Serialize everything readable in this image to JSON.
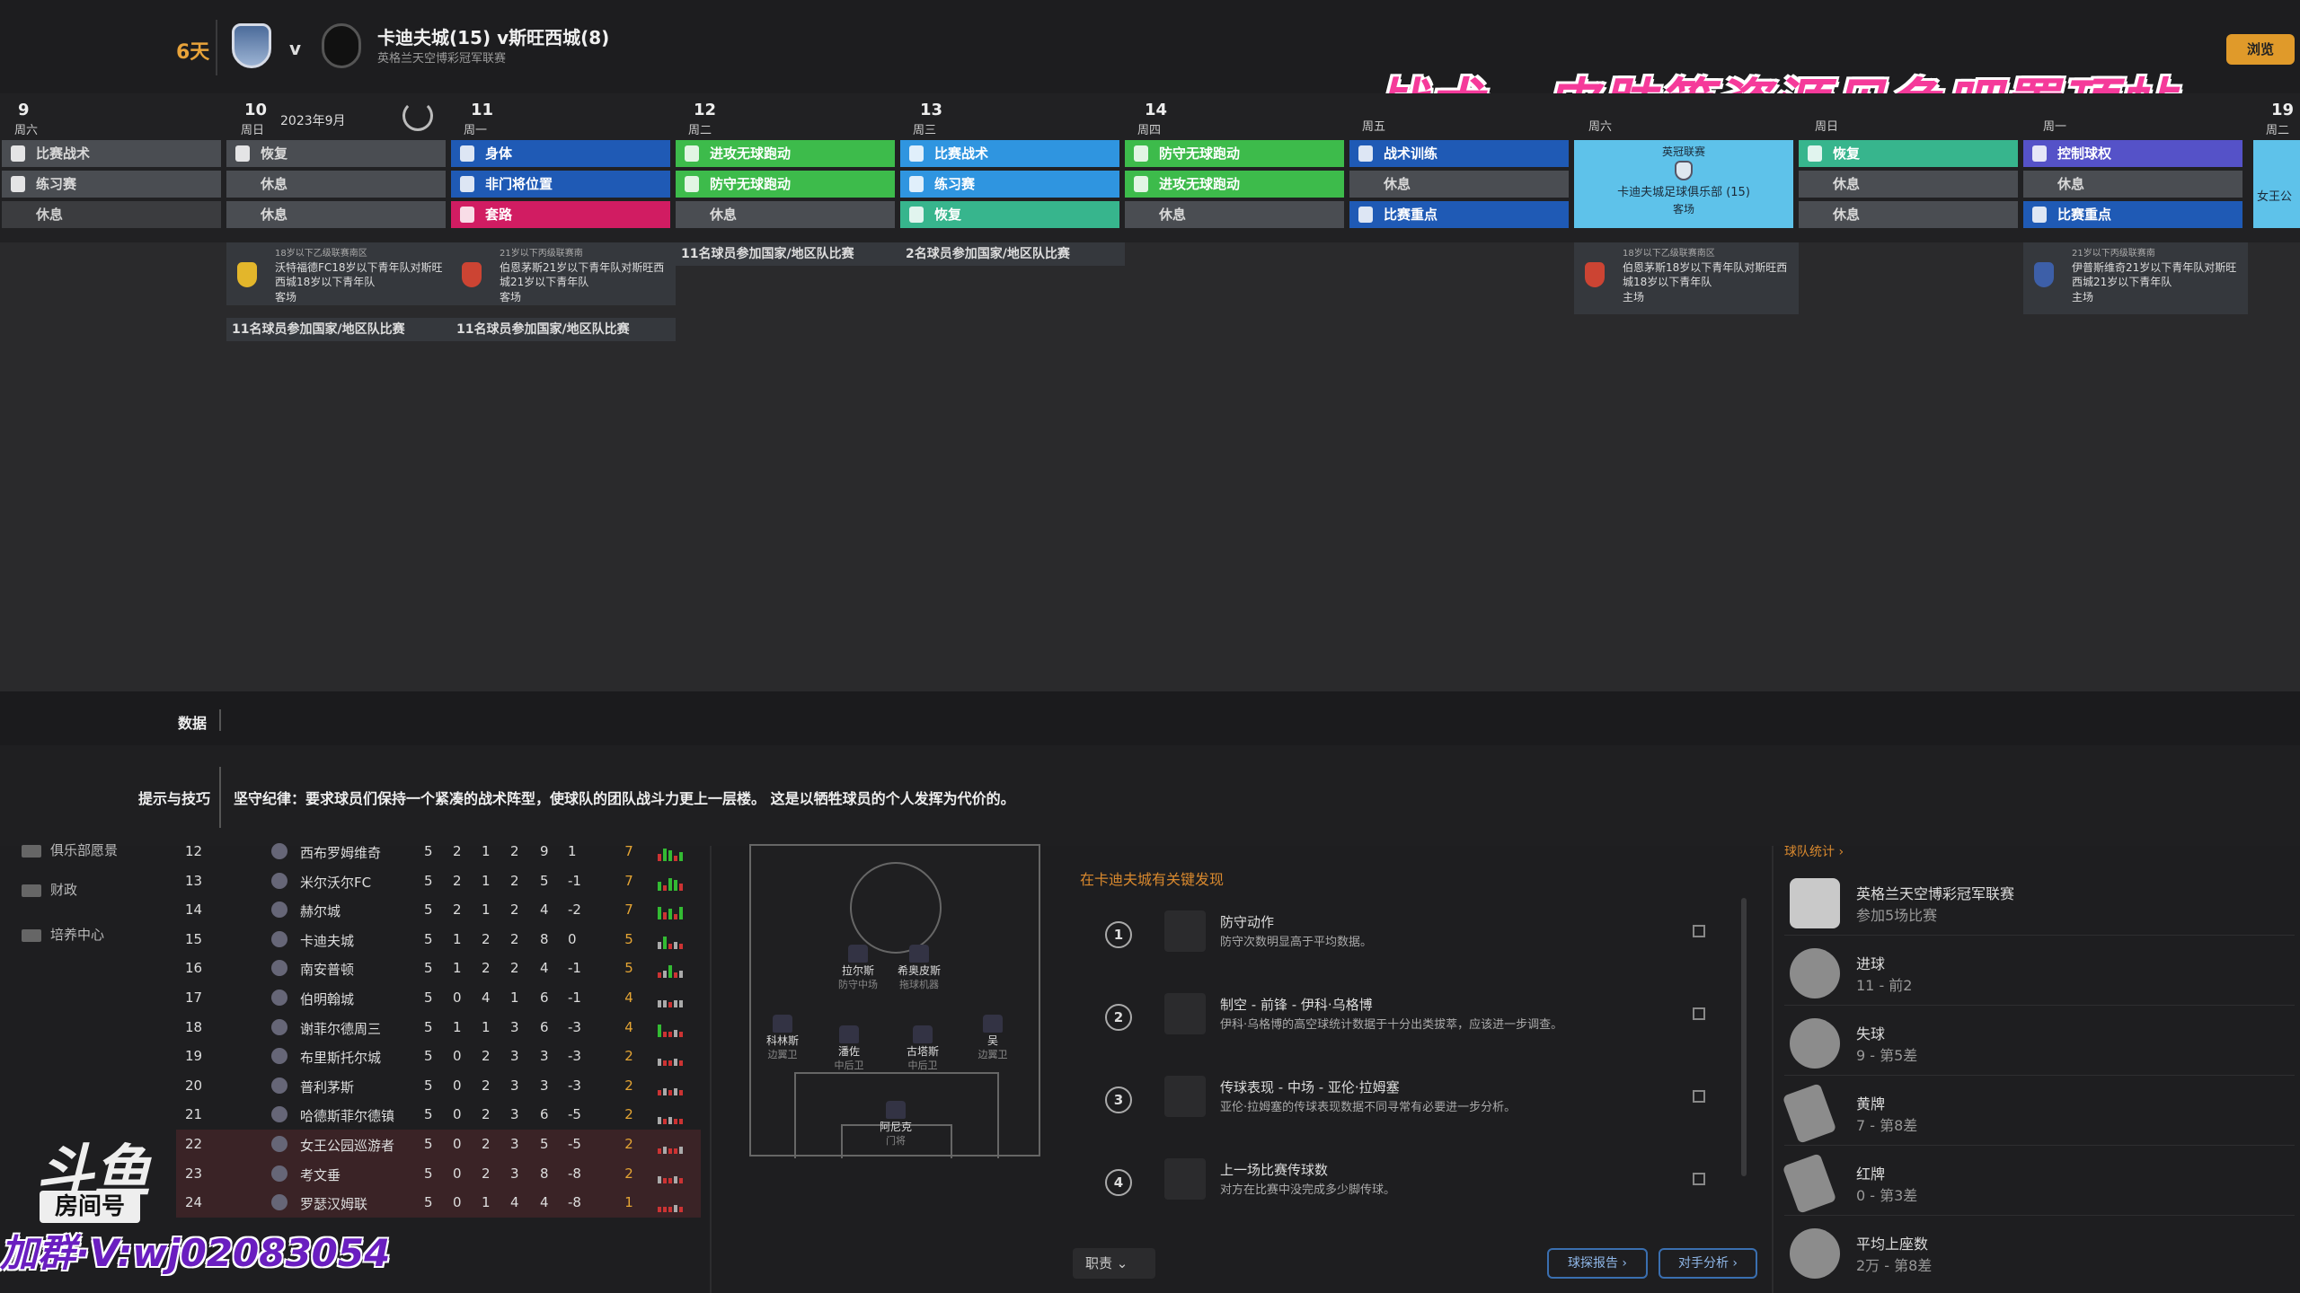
{
  "header": {
    "days_left": "6天",
    "vs": "v",
    "match_title": "卡迪夫城(15) v斯旺西城(8)",
    "competition": "英格兰天空博彩冠军联赛",
    "overview_button": "浏览"
  },
  "banner": "战术、皮肤等资源见鱼吧置顶帖",
  "calendar": {
    "month_label": "2023年9月",
    "days": [
      {
        "num": "9",
        "name": "周六",
        "slots": [
          "比赛战术",
          "练习赛",
          "休息"
        ]
      },
      {
        "num": "10",
        "name": "周日",
        "slots": [
          "恢复",
          "休息",
          "休息"
        ]
      },
      {
        "num": "11",
        "name": "周一",
        "slots": [
          "身体",
          "非门将位置",
          "套路"
        ]
      },
      {
        "num": "12",
        "name": "周二",
        "slots": [
          "进攻无球跑动",
          "防守无球跑动",
          "休息"
        ]
      },
      {
        "num": "13",
        "name": "周三",
        "slots": [
          "比赛战术",
          "练习赛",
          "恢复"
        ]
      },
      {
        "num": "14",
        "name": "周四",
        "slots": [
          "防守无球跑动",
          "进攻无球跑动",
          "休息"
        ]
      },
      {
        "num": "",
        "name": "周五",
        "slots": [
          "战术训练",
          "休息",
          "比赛重点"
        ]
      },
      {
        "num": "",
        "name": "周六",
        "slots": []
      },
      {
        "num": "",
        "name": "周日",
        "slots": [
          "恢复",
          "休息",
          "休息"
        ]
      },
      {
        "num": "",
        "name": "周一",
        "slots": [
          "控制球权",
          "休息",
          "比赛重点"
        ]
      },
      {
        "num": "19",
        "name": "周二",
        "slots": [
          "女王公"
        ]
      }
    ],
    "match_day": {
      "competition": "英冠联赛",
      "team": "卡迪夫城足球俱乐部 (15)",
      "venue": "客场"
    },
    "youth_cards": [
      {
        "league": "18岁以下乙级联赛南区",
        "text": "沃特福德FC18岁以下青年队对斯旺西城18岁以下青年队",
        "venue": "客场"
      },
      {
        "league": "21岁以下丙级联赛南",
        "text": "伯恩茅斯21岁以下青年队对斯旺西城21岁以下青年队",
        "venue": "客场"
      },
      {
        "league": "18岁以下乙级联赛南区",
        "text": "伯恩茅斯18岁以下青年队对斯旺西城18岁以下青年队",
        "venue": "主场"
      },
      {
        "league": "21岁以下丙级联赛南",
        "text": "伊普斯维奇21岁以下青年队对斯旺西城21岁以下青年队",
        "venue": "主场"
      }
    ],
    "notes": [
      "11名球员参加国家/地区队比赛",
      "11名球员参加国家/地区队比赛",
      "11名球员参加国家/地区队比赛",
      "2名球员参加国家/地区队比赛"
    ]
  },
  "data_label": "数据",
  "tips": {
    "label": "提示与技巧",
    "text": "坚守纪律：要求球员们保持一个紧凑的战术阵型，使球队的团队战斗力更上一层楼。 这是以牺牲球员的个人发挥为代价的。"
  },
  "sidebar": [
    "俱乐部愿景",
    "财政",
    "培养中心"
  ],
  "league_table": [
    {
      "pos": "12",
      "team": "西布罗姆维奇",
      "p": "5",
      "w": "2",
      "d": "1",
      "l": "2",
      "gf": "9",
      "gd": "1",
      "pts": "7",
      "hl": false
    },
    {
      "pos": "13",
      "team": "米尔沃尔FC",
      "p": "5",
      "w": "2",
      "d": "1",
      "l": "2",
      "gf": "5",
      "gd": "-1",
      "pts": "7",
      "hl": false
    },
    {
      "pos": "14",
      "team": "赫尔城",
      "p": "5",
      "w": "2",
      "d": "1",
      "l": "2",
      "gf": "4",
      "gd": "-2",
      "pts": "7",
      "hl": false
    },
    {
      "pos": "15",
      "team": "卡迪夫城",
      "p": "5",
      "w": "1",
      "d": "2",
      "l": "2",
      "gf": "8",
      "gd": "0",
      "pts": "5",
      "hl": false
    },
    {
      "pos": "16",
      "team": "南安普顿",
      "p": "5",
      "w": "1",
      "d": "2",
      "l": "2",
      "gf": "4",
      "gd": "-1",
      "pts": "5",
      "hl": false
    },
    {
      "pos": "17",
      "team": "伯明翰城",
      "p": "5",
      "w": "0",
      "d": "4",
      "l": "1",
      "gf": "6",
      "gd": "-1",
      "pts": "4",
      "hl": false
    },
    {
      "pos": "18",
      "team": "谢菲尔德周三",
      "p": "5",
      "w": "1",
      "d": "1",
      "l": "3",
      "gf": "6",
      "gd": "-3",
      "pts": "4",
      "hl": false
    },
    {
      "pos": "19",
      "team": "布里斯托尔城",
      "p": "5",
      "w": "0",
      "d": "2",
      "l": "3",
      "gf": "3",
      "gd": "-3",
      "pts": "2",
      "hl": false
    },
    {
      "pos": "20",
      "team": "普利茅斯",
      "p": "5",
      "w": "0",
      "d": "2",
      "l": "3",
      "gf": "3",
      "gd": "-3",
      "pts": "2",
      "hl": false
    },
    {
      "pos": "21",
      "team": "哈德斯菲尔德镇",
      "p": "5",
      "w": "0",
      "d": "2",
      "l": "3",
      "gf": "6",
      "gd": "-5",
      "pts": "2",
      "hl": false
    },
    {
      "pos": "22",
      "team": "女王公园巡游者",
      "p": "5",
      "w": "0",
      "d": "2",
      "l": "3",
      "gf": "5",
      "gd": "-5",
      "pts": "2",
      "hl": true
    },
    {
      "pos": "23",
      "team": "考文垂",
      "p": "5",
      "w": "0",
      "d": "2",
      "l": "3",
      "gf": "8",
      "gd": "-8",
      "pts": "2",
      "hl": true
    },
    {
      "pos": "24",
      "team": "罗瑟汉姆联",
      "p": "5",
      "w": "0",
      "d": "1",
      "l": "4",
      "gf": "4",
      "gd": "-8",
      "pts": "1",
      "hl": true
    }
  ],
  "pitch_players": [
    {
      "name": "拉尔斯",
      "role": "防守中场"
    },
    {
      "name": "希奥皮斯",
      "role": "拖球机器"
    },
    {
      "name": "科林斯",
      "role": "边翼卫"
    },
    {
      "name": "潘佐",
      "role": "中后卫"
    },
    {
      "name": "古塔斯",
      "role": "中后卫"
    },
    {
      "name": "吴",
      "role": "边翼卫"
    },
    {
      "name": "阿尼克",
      "role": "门将"
    }
  ],
  "findings": {
    "title": "在卡迪夫城有关键发现",
    "items": [
      {
        "num": "1",
        "head": "防守动作",
        "sub": "防守次数明显高于平均数据。"
      },
      {
        "num": "2",
        "head": "制空 - 前锋 - 伊科·乌格博",
        "sub": "伊科·乌格博的高空球统计数据于十分出类拔萃，应该进一步调查。"
      },
      {
        "num": "3",
        "head": "传球表现 - 中场 - 亚伦·拉姆塞",
        "sub": "亚伦·拉姆塞的传球表现数据不同寻常有必要进一步分析。"
      },
      {
        "num": "4",
        "head": "上一场比赛传球数",
        "sub": "对方在比赛中没完成多少脚传球。"
      }
    ],
    "role_select": "职责",
    "scout_button": "球探报告 ›",
    "opp_button": "对手分析 ›"
  },
  "team_stats": {
    "title": "球队统计 ›",
    "rows": [
      {
        "l1": "英格兰天空博彩冠军联赛",
        "l2": "参加5场比赛"
      },
      {
        "l1": "进球",
        "l2": "11 - 前2"
      },
      {
        "l1": "失球",
        "l2": "9 - 第5差"
      },
      {
        "l1": "黄牌",
        "l2": "7 - 第8差"
      },
      {
        "l1": "红牌",
        "l2": "0 - 第3差"
      },
      {
        "l1": "平均上座数",
        "l2": "2万 - 第8差"
      }
    ]
  },
  "watermark": {
    "logo": "斗鱼",
    "sub": "房间号",
    "qq": "加群·V:wj02083054"
  }
}
